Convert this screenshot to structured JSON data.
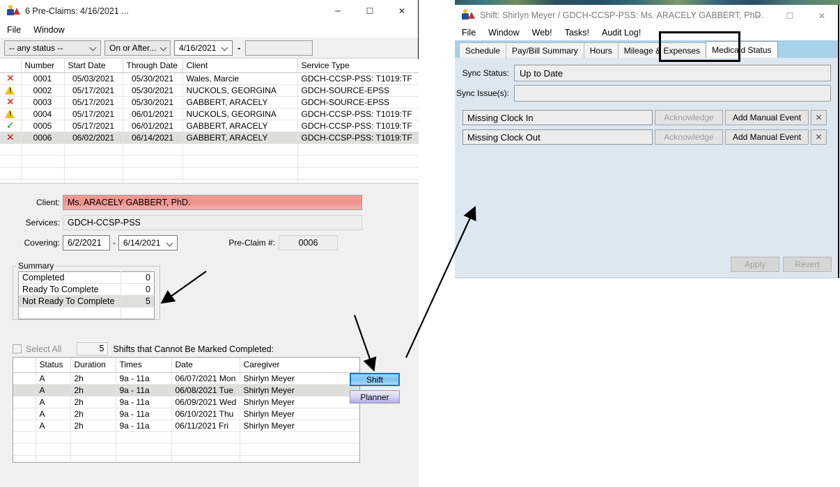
{
  "preclaims_window": {
    "title": "6 Pre-Claims: 4/16/2021 ...",
    "icon": "people-icon",
    "window_controls": {
      "minimize": "─",
      "maximize": "☐",
      "close": "✕"
    },
    "menu": [
      "File",
      "Window"
    ],
    "filters": {
      "status": "-- any status --",
      "date_mode": "On or After...",
      "date_from": "4/16/2021",
      "separator": "-",
      "date_to": ""
    },
    "grid": {
      "columns": [
        "",
        "Number",
        "Start Date",
        "Through Date",
        "Client",
        "Service Type"
      ],
      "rows": [
        {
          "icon": "x-red",
          "number": "0001",
          "start": "05/03/2021",
          "through": "05/30/2021",
          "client": "Wales, Marcie",
          "service": "GDCH-CCSP-PSS: T1019:TF",
          "selected": false
        },
        {
          "icon": "warn-yellow",
          "number": "0002",
          "start": "05/17/2021",
          "through": "05/30/2021",
          "client": "NUCKOLS, GEORGINA",
          "service": "GDCH-SOURCE-EPSS",
          "selected": false
        },
        {
          "icon": "x-red",
          "number": "0003",
          "start": "05/17/2021",
          "through": "05/30/2021",
          "client": "GABBERT, ARACELY",
          "service": "GDCH-SOURCE-EPSS",
          "selected": false
        },
        {
          "icon": "warn-yellow",
          "number": "0004",
          "start": "05/17/2021",
          "through": "06/01/2021",
          "client": "NUCKOLS, GEORGINA",
          "service": "GDCH-CCSP-PSS: T1019:TF",
          "selected": false
        },
        {
          "icon": "check-green",
          "number": "0005",
          "start": "05/17/2021",
          "through": "06/01/2021",
          "client": "GABBERT, ARACELY",
          "service": "GDCH-CCSP-PSS: T1019:TF",
          "selected": false
        },
        {
          "icon": "x-red",
          "number": "0006",
          "start": "06/02/2021",
          "through": "06/14/2021",
          "client": "GABBERT, ARACELY",
          "service": "GDCH-CCSP-PSS: T1019:TF",
          "selected": true
        }
      ]
    },
    "detail": {
      "client_label": "Client:",
      "client_value": "Ms. ARACELY GABBERT, PhD.",
      "services_label": "Services:",
      "services_value": "GDCH-CCSP-PSS",
      "covering_label": "Covering:",
      "covering_from": "6/2/2021",
      "covering_dash": "-",
      "covering_to": "6/14/2021",
      "preclaim_label": "Pre-Claim #:",
      "preclaim_value": "0006"
    },
    "summary": {
      "legend": "Summary",
      "rows": [
        {
          "label": "Completed",
          "value": "0",
          "highlight": false
        },
        {
          "label": "Ready To Complete",
          "value": "0",
          "highlight": false
        },
        {
          "label": "Not Ready To Complete",
          "value": "5",
          "highlight": true
        },
        {
          "label": "",
          "value": "",
          "highlight": false
        }
      ]
    },
    "select_all_label": "Select All",
    "cannot_count": "5",
    "cannot_label": "Shifts that Cannot Be Marked Completed:",
    "shifts_grid": {
      "columns": [
        "",
        "Status",
        "Duration",
        "Times",
        "Date",
        "Caregiver"
      ],
      "rows": [
        {
          "status": "A",
          "duration": "2h",
          "times": "9a - 11a",
          "date": "06/07/2021 Mon",
          "caregiver": "Shirlyn Meyer",
          "selected": false
        },
        {
          "status": "A",
          "duration": "2h",
          "times": "9a - 11a",
          "date": "06/08/2021 Tue",
          "caregiver": "Shirlyn Meyer",
          "selected": true
        },
        {
          "status": "A",
          "duration": "2h",
          "times": "9a - 11a",
          "date": "06/09/2021 Wed",
          "caregiver": "Shirlyn Meyer",
          "selected": false
        },
        {
          "status": "A",
          "duration": "2h",
          "times": "9a - 11a",
          "date": "06/10/2021 Thu",
          "caregiver": "Shirlyn Meyer",
          "selected": false
        },
        {
          "status": "A",
          "duration": "2h",
          "times": "9a - 11a",
          "date": "06/11/2021 Fri",
          "caregiver": "Shirlyn Meyer",
          "selected": false
        }
      ]
    },
    "side_buttons": {
      "shift": "Shift",
      "planner": "Planner"
    }
  },
  "shift_window": {
    "title": "Shift: Shirlyn Meyer / GDCH-CCSP-PSS: Ms. ARACELY GABBERT, PhD.",
    "icon": "people-icon",
    "window_controls": {
      "minimize": "─",
      "maximize": "☐",
      "close": "✕"
    },
    "menu": [
      "File",
      "Window",
      "Web!",
      "Tasks!",
      "Audit Log!"
    ],
    "tabs": [
      {
        "label": "Schedule",
        "active": false
      },
      {
        "label": "Pay/Bill Summary",
        "active": false
      },
      {
        "label": "Hours",
        "active": false
      },
      {
        "label": "Mileage & Expenses",
        "active": false
      },
      {
        "label": "Medicaid Status",
        "active": true
      }
    ],
    "sync_status_label": "Sync Status:",
    "sync_status_value": "Up to Date",
    "sync_issues_label": "Sync Issue(s):",
    "sync_issues_value": "",
    "issues": [
      {
        "name": "Missing Clock In",
        "acknowledge": "Acknowledge",
        "add_event": "Add Manual Event",
        "remove": "✕"
      },
      {
        "name": "Missing Clock Out",
        "acknowledge": "Acknowledge",
        "add_event": "Add Manual Event",
        "remove": "✕"
      }
    ],
    "apply_label": "Apply",
    "revert_label": "Revert"
  },
  "annotations": {
    "arrow_to_summary": "arrow pointing at Not Ready To Complete row",
    "arrow_to_shift_button": "arrow pointing at Shift button",
    "arrow_to_shift_window": "arrow pointing at Medicaid Status pane",
    "tab_highlight": "black rectangle around Medicaid Status tab"
  }
}
